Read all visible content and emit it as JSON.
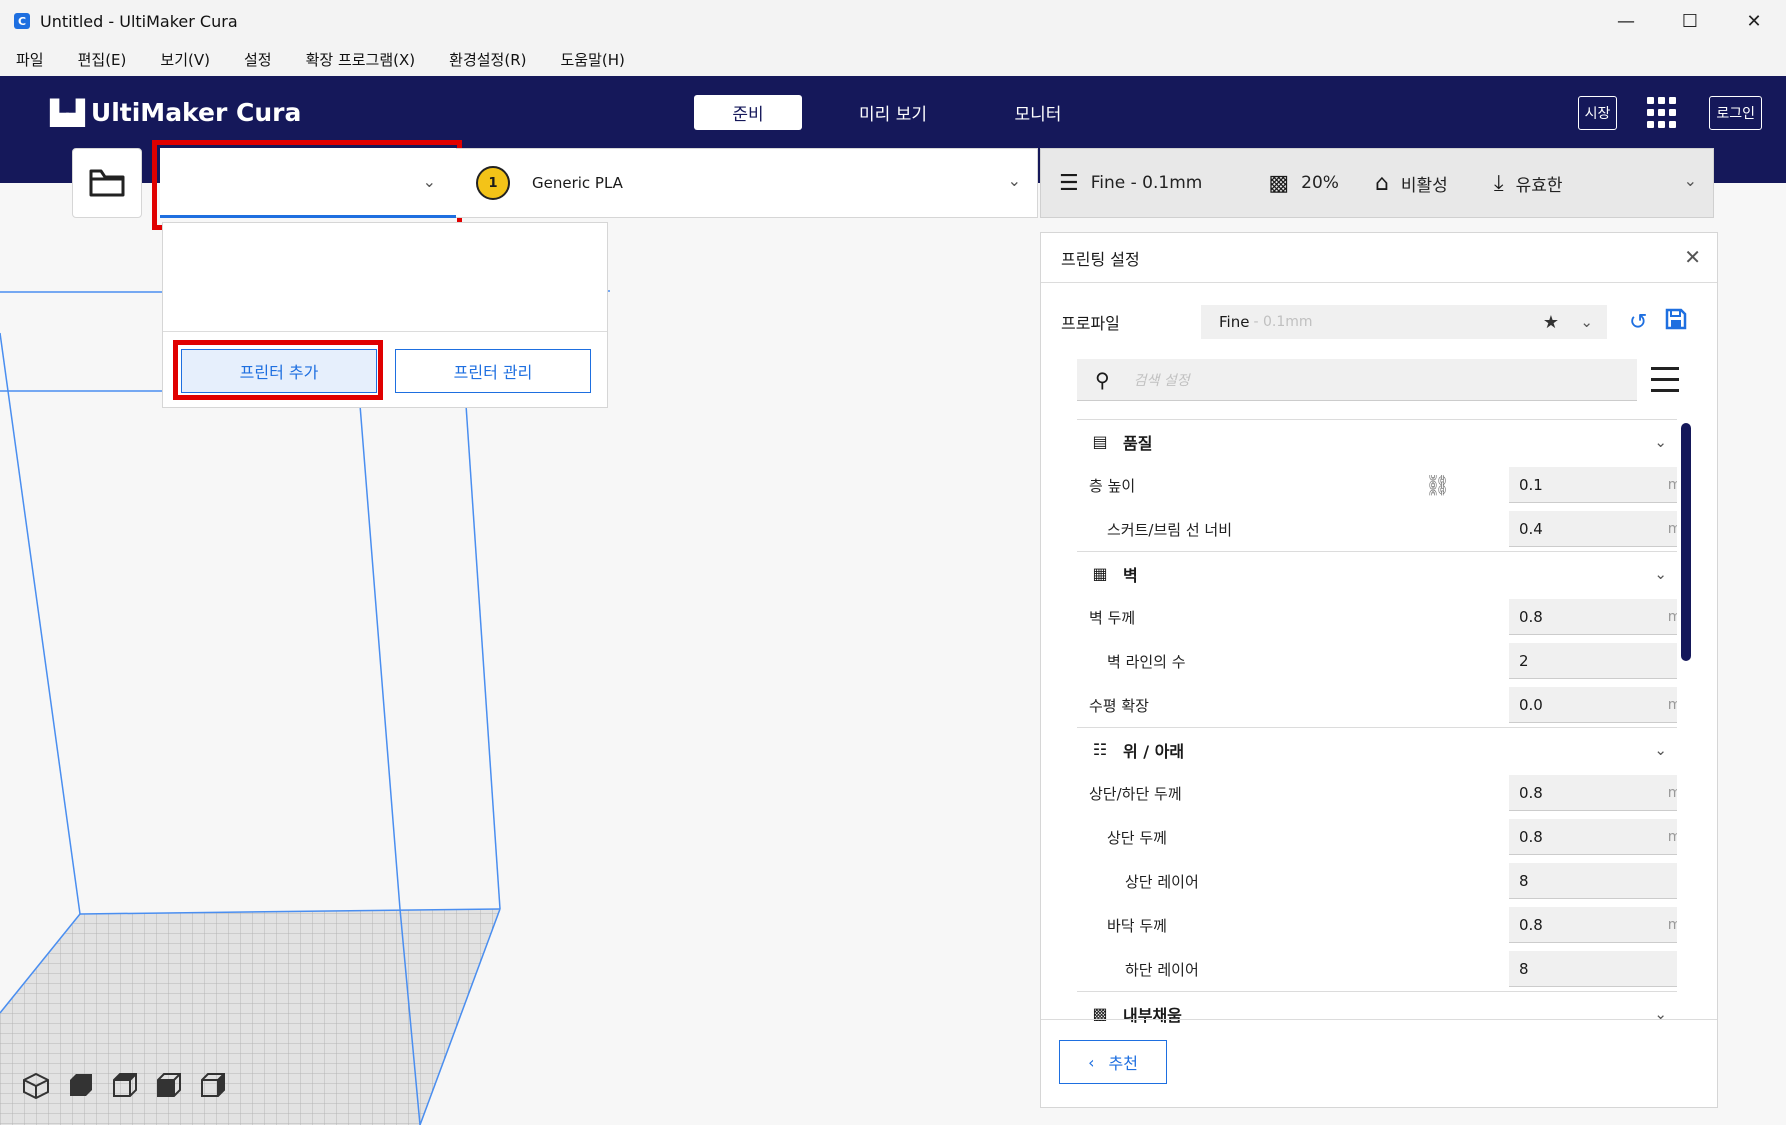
{
  "window": {
    "app_icon": "C",
    "title": "Untitled - UltiMaker Cura",
    "minimize_glyph": "—",
    "maximize_glyph": "☐",
    "close_glyph": "✕"
  },
  "menu": [
    "파일",
    "편집(E)",
    "보기(V)",
    "설정",
    "확장 프로그램(X)",
    "환경설정(R)",
    "도움말(H)"
  ],
  "header": {
    "logo_text": "UltiMaker Cura",
    "tabs": [
      {
        "label": "준비",
        "active": true
      },
      {
        "label": "미리 보기",
        "active": false
      },
      {
        "label": "모니터",
        "active": false
      }
    ],
    "marketplace_label": "시장",
    "login_label": "로그인"
  },
  "toolbar": {
    "printer_selected": "",
    "extruder_number": "1",
    "material": "Generic PLA",
    "print_setup": {
      "profile": "Fine - 0.1mm",
      "infill": "20%",
      "support": "비활성",
      "adhesion": "유효한"
    }
  },
  "printer_popup": {
    "add_printer": "프린터 추가",
    "manage_printers": "프린터 관리"
  },
  "settings": {
    "title": "프린팅 설정",
    "profile_label": "프로파일",
    "profile_name": "Fine",
    "profile_suffix": "- 0.1mm",
    "search_placeholder": "검색 설정",
    "categories": [
      {
        "label": "품질",
        "icon": "quality-icon",
        "rows": [
          {
            "label": "층 높이",
            "indent": 0,
            "value": "0.1",
            "unit": "mm",
            "linked": true
          },
          {
            "label": "스커트/브림 선 너비",
            "indent": 1,
            "value": "0.4",
            "unit": "mm",
            "linked": false
          }
        ]
      },
      {
        "label": "벽",
        "icon": "walls-icon",
        "rows": [
          {
            "label": "벽 두께",
            "indent": 0,
            "value": "0.8",
            "unit": "mm",
            "linked": false
          },
          {
            "label": "벽 라인의 수",
            "indent": 1,
            "value": "2",
            "unit": "",
            "linked": false
          },
          {
            "label": "수평 확장",
            "indent": 0,
            "value": "0.0",
            "unit": "mm",
            "linked": false
          }
        ]
      },
      {
        "label": "위 / 아래",
        "icon": "top-bottom-icon",
        "rows": [
          {
            "label": "상단/하단 두께",
            "indent": 0,
            "value": "0.8",
            "unit": "mm",
            "linked": false
          },
          {
            "label": "상단 두께",
            "indent": 1,
            "value": "0.8",
            "unit": "mm",
            "linked": false
          },
          {
            "label": "상단 레이어",
            "indent": 2,
            "value": "8",
            "unit": "",
            "linked": false
          },
          {
            "label": "바닥 두께",
            "indent": 1,
            "value": "0.8",
            "unit": "mm",
            "linked": false
          },
          {
            "label": "하단 레이어",
            "indent": 2,
            "value": "8",
            "unit": "",
            "linked": false
          }
        ]
      },
      {
        "label": "내부채움",
        "icon": "infill-icon",
        "rows": []
      }
    ],
    "recommended_label": "추천"
  },
  "colors": {
    "header_bg": "#15185a",
    "accent": "#1e6fe0",
    "highlight": "#e00000"
  }
}
